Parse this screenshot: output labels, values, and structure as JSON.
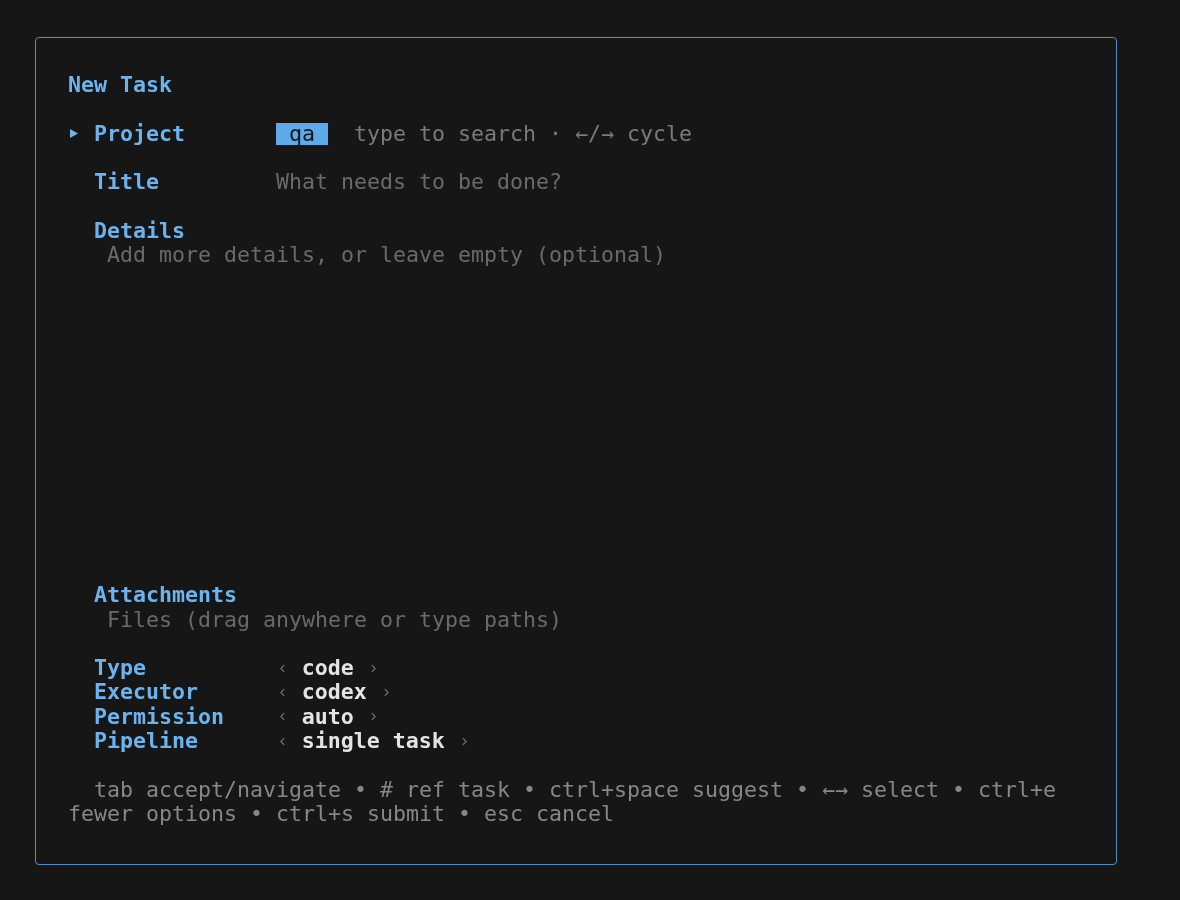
{
  "form": {
    "title": "New Task",
    "fields": [
      {
        "kind": "search",
        "label": "Project",
        "focused": true,
        "value": "qa",
        "hint": "type to search · ←/→ cycle"
      },
      {
        "kind": "text",
        "label": "Title",
        "focused": false,
        "placeholder": "What needs to be done?"
      },
      {
        "kind": "textarea",
        "label": "Details",
        "focused": false,
        "placeholder": "Add more details, or leave empty (optional)"
      },
      {
        "kind": "files",
        "label": "Attachments",
        "focused": false,
        "placeholder": "Files (drag anywhere or type paths)"
      }
    ],
    "options": [
      {
        "label": "Type",
        "value": "code"
      },
      {
        "label": "Executor",
        "value": "codex"
      },
      {
        "label": "Permission",
        "value": "auto"
      },
      {
        "label": "Pipeline",
        "value": "single task"
      }
    ],
    "help": "tab accept/navigate • # ref task • ctrl+space suggest • ←→ select • ctrl+e fewer options • ctrl+s submit • esc cancel"
  }
}
